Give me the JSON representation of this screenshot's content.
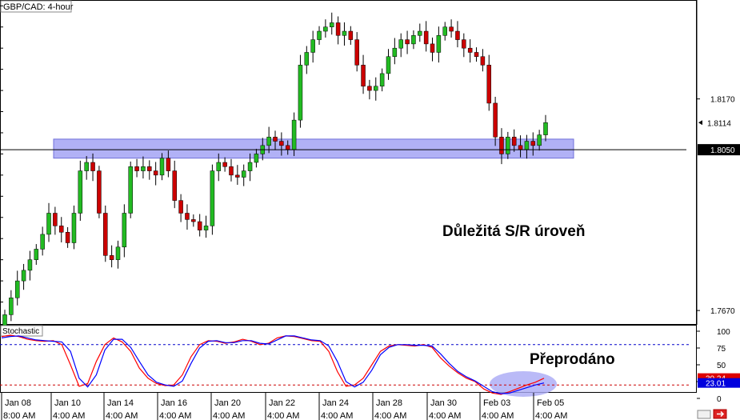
{
  "chart_data": [
    {
      "type": "candlestick",
      "title": "GBP/CAD: 4-hour",
      "ylim": [
        1.764,
        1.84
      ],
      "y_ticks": [
        "1.8170",
        "1.7670"
      ],
      "x_tick_labels": [
        {
          "date": "Jan 08",
          "time": "8:00 AM"
        },
        {
          "date": "Jan 10",
          "time": "4:00 AM"
        },
        {
          "date": "Jan 14",
          "time": "4:00 AM"
        },
        {
          "date": "Jan 16",
          "time": "4:00 AM"
        },
        {
          "date": "Jan 20",
          "time": "4:00 AM"
        },
        {
          "date": "Jan 22",
          "time": "4:00 AM"
        },
        {
          "date": "Jan 24",
          "time": "4:00 AM"
        },
        {
          "date": "Jan 28",
          "time": "4:00 AM"
        },
        {
          "date": "Jan 30",
          "time": "4:00 AM"
        },
        {
          "date": "Feb 03",
          "time": "4:00 AM"
        },
        {
          "date": "Feb 05",
          "time": "4:00 AM"
        }
      ],
      "current_price_label": "1.8114",
      "horizontal_line": {
        "value": 1.805,
        "label": "1.8050"
      },
      "sr_zone": {
        "low": 1.803,
        "high": 1.8075
      },
      "annotation": "Důležitá S/R úroveň",
      "colors": {
        "bull": "#22bb22",
        "bear": "#cc0000",
        "zone": "#a9a9f5",
        "line": "#000000"
      },
      "close_sequence": [
        1.766,
        1.77,
        1.774,
        1.7765,
        1.779,
        1.7815,
        1.785,
        1.79,
        1.787,
        1.7855,
        1.783,
        1.79,
        1.8,
        1.802,
        1.8,
        1.79,
        1.78,
        1.779,
        1.782,
        1.79,
        1.801,
        1.8,
        1.801,
        1.8,
        1.799,
        1.803,
        1.8,
        1.793,
        1.79,
        1.7885,
        1.788,
        1.786,
        1.787,
        1.8,
        1.802,
        1.801,
        1.799,
        1.7985,
        1.8,
        1.802,
        1.804,
        1.806,
        1.808,
        1.807,
        1.806,
        1.805,
        1.812,
        1.825,
        1.828,
        1.831,
        1.833,
        1.834,
        1.835,
        1.832,
        1.833,
        1.831,
        1.825,
        1.82,
        1.819,
        1.82,
        1.823,
        1.827,
        1.829,
        1.831,
        1.83,
        1.832,
        1.833,
        1.83,
        1.828,
        1.832,
        1.834,
        1.833,
        1.831,
        1.829,
        1.828,
        1.827,
        1.825,
        1.816,
        1.808,
        1.804,
        1.808,
        1.806,
        1.805,
        1.807,
        1.806,
        1.8085,
        1.8114
      ]
    },
    {
      "type": "line",
      "title": "Stochastic",
      "ylim": [
        0,
        100
      ],
      "y_ticks": [
        "100",
        "75",
        "50",
        "25",
        "0"
      ],
      "levels": [
        80,
        20
      ],
      "current_values": [
        "30.24",
        "23.01"
      ],
      "annotation": "Přeprodáno",
      "series": [
        {
          "color": "#ff0000",
          "values": [
            92,
            94,
            92,
            88,
            86,
            85,
            86,
            80,
            50,
            18,
            22,
            55,
            80,
            90,
            84,
            70,
            45,
            30,
            22,
            19,
            20,
            35,
            62,
            80,
            86,
            85,
            82,
            84,
            88,
            85,
            80,
            82,
            90,
            93,
            92,
            89,
            86,
            85,
            70,
            40,
            18,
            20,
            30,
            50,
            70,
            78,
            80,
            79,
            78,
            80,
            76,
            60,
            48,
            38,
            30,
            25,
            14,
            8,
            6,
            10,
            15,
            20,
            24,
            30
          ]
        },
        {
          "color": "#0000ff",
          "values": [
            90,
            92,
            93,
            90,
            87,
            86,
            85,
            84,
            70,
            30,
            17,
            35,
            72,
            88,
            88,
            76,
            55,
            35,
            24,
            20,
            18,
            26,
            52,
            75,
            85,
            86,
            83,
            83,
            86,
            86,
            82,
            81,
            87,
            93,
            93,
            90,
            87,
            86,
            78,
            55,
            25,
            17,
            24,
            42,
            65,
            76,
            80,
            80,
            79,
            79,
            78,
            66,
            52,
            40,
            32,
            26,
            18,
            10,
            7,
            8,
            12,
            16,
            20,
            23
          ]
        }
      ]
    }
  ]
}
